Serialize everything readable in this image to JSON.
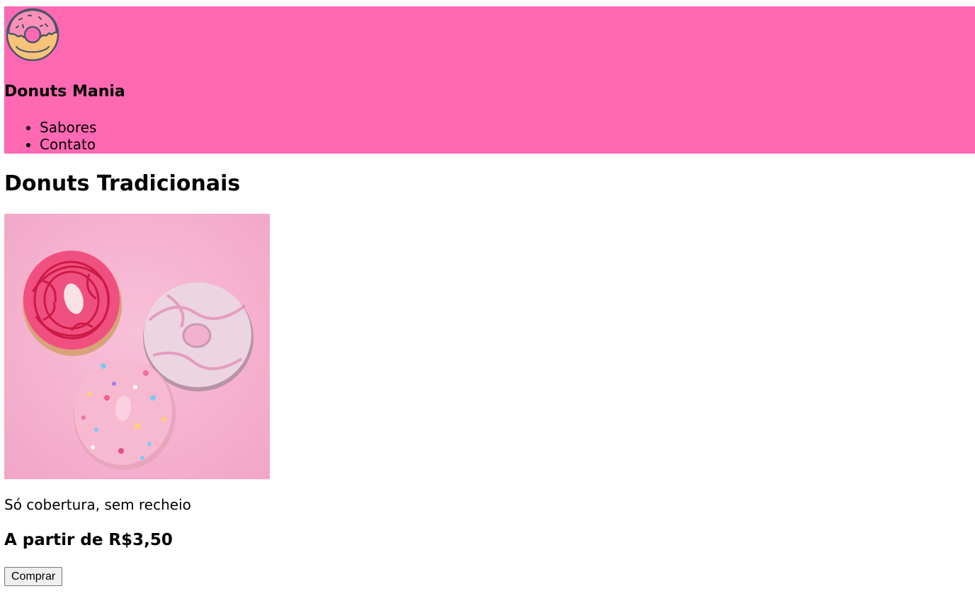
{
  "header": {
    "logo_icon": "donut-icon",
    "brand": "Donuts Mania",
    "nav": [
      {
        "label": "Sabores"
      },
      {
        "label": "Contato"
      }
    ],
    "background": "#ff69b4"
  },
  "product": {
    "section_title": "Donuts Tradicionais",
    "image": "pink-donuts-photo",
    "description": "Só cobertura, sem recheio",
    "price": "A partir de R$3,50",
    "buy_label": "Comprar"
  }
}
